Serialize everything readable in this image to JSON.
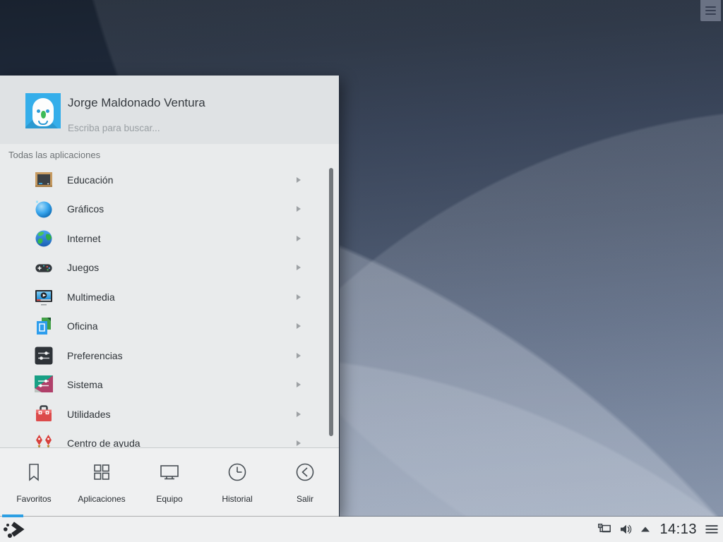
{
  "desktop": {
    "toolbox_icon": "hamburger-icon"
  },
  "launcher": {
    "user_name": "Jorge Maldonado Ventura",
    "search_hint": "Escriba para buscar...",
    "breadcrumb": "Todas las aplicaciones",
    "categories": [
      {
        "label": "Educación",
        "icon": "education-icon"
      },
      {
        "label": "Gráficos",
        "icon": "graphics-icon"
      },
      {
        "label": "Internet",
        "icon": "internet-icon"
      },
      {
        "label": "Juegos",
        "icon": "games-icon"
      },
      {
        "label": "Multimedia",
        "icon": "multimedia-icon"
      },
      {
        "label": "Oficina",
        "icon": "office-icon"
      },
      {
        "label": "Preferencias",
        "icon": "preferences-icon"
      },
      {
        "label": "Sistema",
        "icon": "system-icon"
      },
      {
        "label": "Utilidades",
        "icon": "utilities-icon"
      },
      {
        "label": "Centro de ayuda",
        "icon": "help-icon"
      }
    ],
    "tabs": [
      {
        "label": "Favoritos",
        "icon": "bookmark-icon"
      },
      {
        "label": "Aplicaciones",
        "icon": "grid-icon"
      },
      {
        "label": "Equipo",
        "icon": "computer-icon"
      },
      {
        "label": "Historial",
        "icon": "clock-icon"
      },
      {
        "label": "Salir",
        "icon": "leave-icon"
      }
    ],
    "active_tab": "Aplicaciones"
  },
  "panel": {
    "clock": "14:13",
    "tray_icons": [
      "wired-network-icon",
      "volume-icon",
      "expand-arrow-icon",
      "overflow-menu-icon"
    ],
    "launcher_button_icon": "app-menu-icon"
  },
  "colors": {
    "accent": "#2d9fe3",
    "panel_bg": "#eff0f1",
    "popup_bg": "#e9ebec",
    "wallpaper_top": "#19222f",
    "wallpaper_bottom": "#74839c"
  }
}
